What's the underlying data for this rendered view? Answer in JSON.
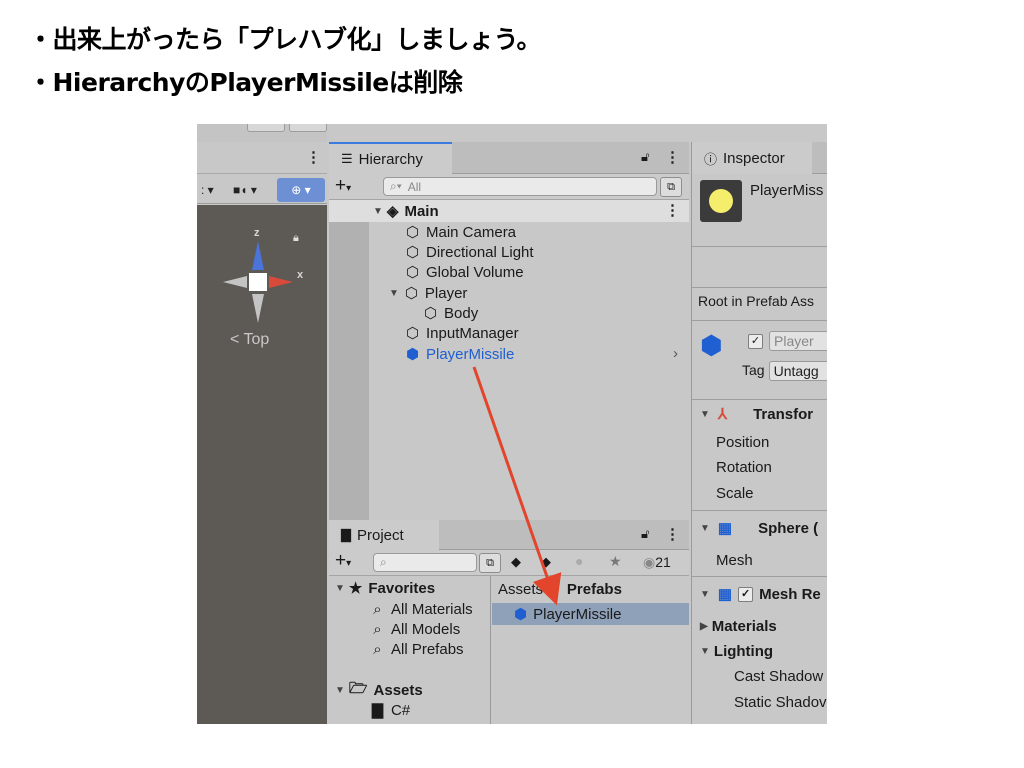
{
  "bullets": [
    "・出来上がったら「プレハブ化」しましょう。",
    "・HierarchyのPlayerMissileは削除"
  ],
  "scene": {
    "gizmo_axes": [
      "z",
      "x"
    ],
    "view_label": "< Top"
  },
  "hierarchy": {
    "tab": "Hierarchy",
    "search_placeholder": "All",
    "root": "Main",
    "items": [
      {
        "label": "Main Camera",
        "depth": 1
      },
      {
        "label": "Directional Light",
        "depth": 1
      },
      {
        "label": "Global Volume",
        "depth": 1
      },
      {
        "label": "Player",
        "depth": 1,
        "expanded": true
      },
      {
        "label": "Body",
        "depth": 2
      },
      {
        "label": "InputManager",
        "depth": 1
      },
      {
        "label": "PlayerMissile",
        "depth": 1,
        "prefab": true
      }
    ]
  },
  "project": {
    "tab": "Project",
    "count": "21",
    "favorites_label": "Favorites",
    "favorites": [
      "All Materials",
      "All Models",
      "All Prefabs"
    ],
    "assets_label": "Assets",
    "assets_children": [
      "C#"
    ],
    "breadcrumb": {
      "root": "Assets",
      "sep": "▸",
      "folder": "Prefabs"
    },
    "selected_asset": "PlayerMissile"
  },
  "inspector": {
    "tab": "Inspector",
    "object_name": "PlayerMiss",
    "root_in_prefab": "Root in Prefab Ass",
    "name_field": "Player",
    "tag_label": "Tag",
    "tag_value": "Untagg",
    "transform_label": "Transfor",
    "transform_fields": [
      "Position",
      "Rotation",
      "Scale"
    ],
    "sphere_label": "Sphere (",
    "mesh_label": "Mesh",
    "mesh_renderer_label": "Mesh Re",
    "materials_label": "Materials",
    "lighting_label": "Lighting",
    "lighting_fields": [
      "Cast Shadow",
      "Static Shadov"
    ]
  },
  "colors": {
    "arrow": "#e2452b",
    "prefab_blue": "#1f5fd1",
    "selection": "#8fa0b9"
  }
}
